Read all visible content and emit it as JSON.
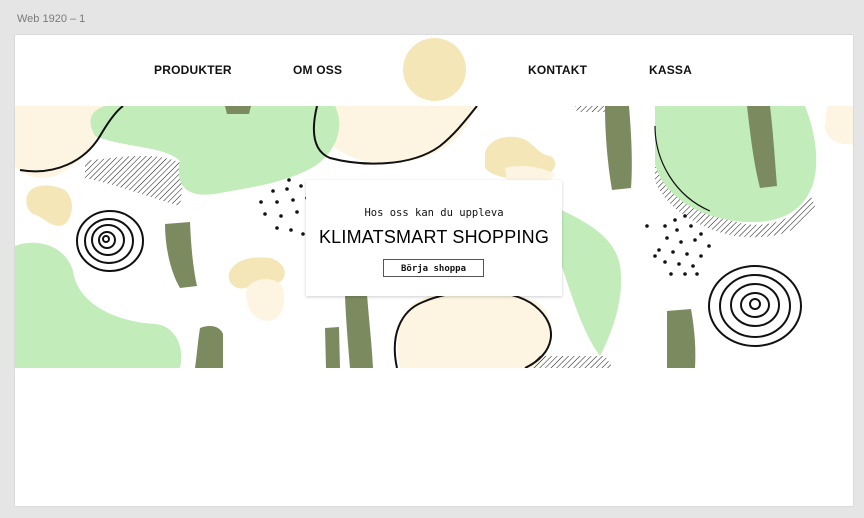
{
  "canvas": {
    "frame_label": "Web 1920 – 1"
  },
  "nav": {
    "items": [
      {
        "label": "PRODUKTER"
      },
      {
        "label": "OM OSS"
      },
      {
        "label": "KONTAKT"
      },
      {
        "label": "KASSA"
      }
    ]
  },
  "logo": {
    "color": "#f5e6b8"
  },
  "hero": {
    "subtitle": "Hos oss kan du uppleva",
    "title": "KLIMATSMART SHOPPING",
    "cta_label": "Börja shoppa"
  },
  "colors": {
    "green_light": "#c2ecba",
    "green_dark": "#7b8b5f",
    "cream": "#fdf5e2",
    "sand": "#f5e6b8",
    "ink": "#111111"
  }
}
